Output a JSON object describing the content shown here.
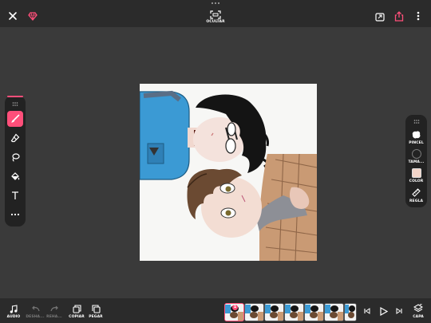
{
  "top": {
    "hide_label": "OCULTAR",
    "icons": [
      "close-icon",
      "gem-icon",
      "hide-frame-icon",
      "export-icon",
      "share-icon",
      "more-vert-icon"
    ]
  },
  "right_panel": {
    "brush_label": "PINCEL",
    "size_label": "TAMA...",
    "color_label": "COLOR",
    "ruler_label": "REGLA",
    "selected_color": "#f2d4c8"
  },
  "bottom": {
    "audio_label": "AUDIO",
    "undo_label": "DESHA...",
    "redo_label": "REHA...",
    "copy_label": "COPIAR",
    "paste_label": "PEGAR",
    "layers_label": "CAPA",
    "selected_frame_badge": "1",
    "frame_count": 6
  },
  "colors": {
    "accent": "#ff4f7a",
    "background": "#3a3a3a",
    "bar": "#2b2b2b",
    "panel": "#222222"
  }
}
